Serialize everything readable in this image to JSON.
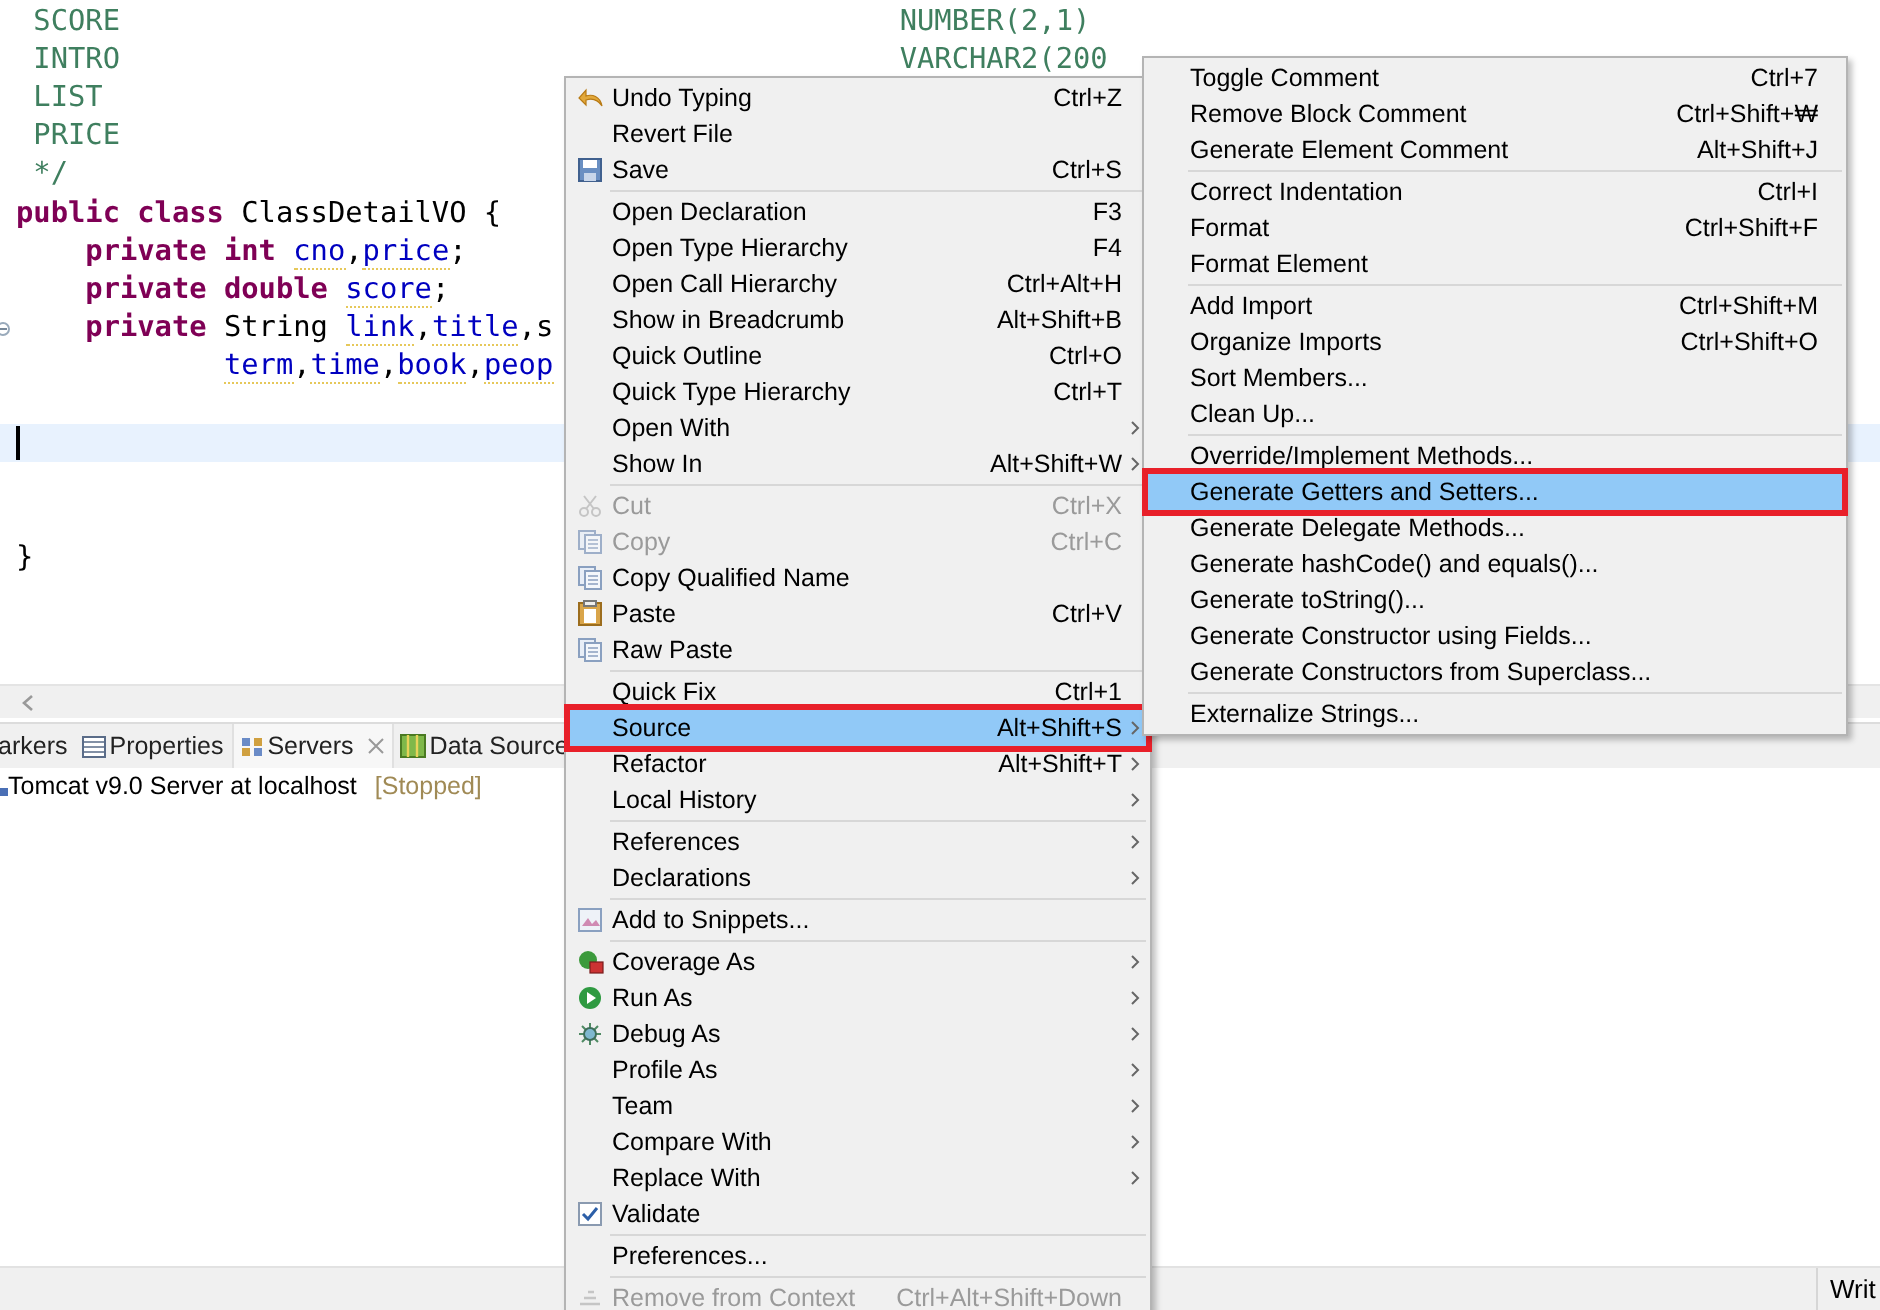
{
  "editor": {
    "lines": [
      {
        "kind": "comment",
        "current": false,
        "name": " SCORE",
        "type": "NUMBER(2,1)"
      },
      {
        "kind": "comment",
        "current": false,
        "name": " INTRO",
        "type": "VARCHAR2(200"
      },
      {
        "kind": "comment",
        "current": false,
        "name": " LIST"
      },
      {
        "kind": "comment",
        "current": false,
        "name": " PRICE"
      },
      {
        "kind": "comment",
        "current": false,
        "name": " */"
      },
      {
        "kind": "code",
        "current": false,
        "tokens": [
          {
            "kind": "keyword",
            "text": "public class"
          },
          {
            "kind": "plain",
            "text": " ClassDetailVO {"
          }
        ]
      },
      {
        "kind": "code",
        "current": false,
        "tokens": [
          {
            "kind": "keyword",
            "text": "    private int "
          },
          {
            "kind": "field",
            "text": "cno"
          },
          {
            "kind": "plain",
            "text": ","
          },
          {
            "kind": "field",
            "text": "price"
          },
          {
            "kind": "plain",
            "text": ";"
          }
        ]
      },
      {
        "kind": "code",
        "current": false,
        "tokens": [
          {
            "kind": "keyword",
            "text": "    private double "
          },
          {
            "kind": "field",
            "text": "score"
          },
          {
            "kind": "plain",
            "text": ";"
          }
        ]
      },
      {
        "kind": "code",
        "current": false,
        "folded": false,
        "tokens": [
          {
            "kind": "keyword",
            "text": "    private"
          },
          {
            "kind": "plain",
            "text": " String "
          },
          {
            "kind": "field",
            "text": "link"
          },
          {
            "kind": "plain",
            "text": ","
          },
          {
            "kind": "field",
            "text": "title"
          },
          {
            "kind": "plain",
            "text": ",s"
          }
        ]
      },
      {
        "kind": "code",
        "current": false,
        "tokens": [
          {
            "kind": "field",
            "text": "            term"
          },
          {
            "kind": "plain",
            "text": ","
          },
          {
            "kind": "field",
            "text": "time"
          },
          {
            "kind": "plain",
            "text": ","
          },
          {
            "kind": "field",
            "text": "book"
          },
          {
            "kind": "plain",
            "text": ","
          },
          {
            "kind": "field",
            "text": "peop"
          }
        ]
      },
      {
        "kind": "blank",
        "current": false
      },
      {
        "kind": "blank",
        "current": true
      },
      {
        "kind": "blank",
        "current": false
      },
      {
        "kind": "blank",
        "current": false
      },
      {
        "kind": "code",
        "current": false,
        "tokens": [
          {
            "kind": "plain",
            "text": "}"
          }
        ]
      }
    ]
  },
  "panel": {
    "tabs": [
      {
        "label": "arkers",
        "kind": "plain",
        "selected": false,
        "closable": false
      },
      {
        "label": "Properties",
        "kind": "table",
        "selected": false,
        "closable": false
      },
      {
        "label": "Servers",
        "kind": "servers",
        "selected": true,
        "closable": true
      },
      {
        "label": "Data Source",
        "kind": "map",
        "selected": false,
        "closable": false
      }
    ],
    "rows": [
      {
        "name": "Tomcat v9.0 Server at localhost",
        "status": "[Stopped]"
      }
    ]
  },
  "status_bar": {
    "mode": "Writ"
  },
  "context_menu": {
    "groups": [
      [
        {
          "label": "Undo Typing",
          "shortcut": "Ctrl+Z",
          "kind": "undo",
          "submenu": false,
          "disabled": false,
          "selected": false
        },
        {
          "label": "Revert File",
          "kind": "plain",
          "submenu": false,
          "disabled": false,
          "selected": false
        },
        {
          "label": "Save",
          "shortcut": "Ctrl+S",
          "kind": "save",
          "submenu": false,
          "disabled": false,
          "selected": false
        }
      ],
      [
        {
          "label": "Open Declaration",
          "shortcut": "F3",
          "kind": "plain",
          "submenu": false,
          "disabled": false,
          "selected": false
        },
        {
          "label": "Open Type Hierarchy",
          "shortcut": "F4",
          "kind": "plain",
          "submenu": false,
          "disabled": false,
          "selected": false
        },
        {
          "label": "Open Call Hierarchy",
          "shortcut": "Ctrl+Alt+H",
          "kind": "plain",
          "submenu": false,
          "disabled": false,
          "selected": false
        },
        {
          "label": "Show in Breadcrumb",
          "shortcut": "Alt+Shift+B",
          "kind": "plain",
          "submenu": false,
          "disabled": false,
          "selected": false
        },
        {
          "label": "Quick Outline",
          "shortcut": "Ctrl+O",
          "kind": "plain",
          "submenu": false,
          "disabled": false,
          "selected": false
        },
        {
          "label": "Quick Type Hierarchy",
          "shortcut": "Ctrl+T",
          "kind": "plain",
          "submenu": false,
          "disabled": false,
          "selected": false
        },
        {
          "label": "Open With",
          "kind": "plain",
          "submenu": true,
          "disabled": false,
          "selected": false
        },
        {
          "label": "Show In",
          "shortcut": "Alt+Shift+W",
          "kind": "plain",
          "submenu": true,
          "disabled": false,
          "selected": false
        }
      ],
      [
        {
          "label": "Cut",
          "shortcut": "Ctrl+X",
          "kind": "cut",
          "submenu": false,
          "disabled": true,
          "selected": false
        },
        {
          "label": "Copy",
          "shortcut": "Ctrl+C",
          "kind": "copy",
          "submenu": false,
          "disabled": true,
          "selected": false
        },
        {
          "label": "Copy Qualified Name",
          "kind": "copy",
          "submenu": false,
          "disabled": false,
          "selected": false
        },
        {
          "label": "Paste",
          "shortcut": "Ctrl+V",
          "kind": "paste",
          "submenu": false,
          "disabled": false,
          "selected": false
        },
        {
          "label": "Raw Paste",
          "kind": "copy",
          "submenu": false,
          "disabled": false,
          "selected": false
        }
      ],
      [
        {
          "label": "Quick Fix",
          "shortcut": "Ctrl+1",
          "kind": "plain",
          "submenu": false,
          "disabled": false,
          "selected": false
        },
        {
          "label": "Source",
          "shortcut": "Alt+Shift+S",
          "kind": "plain",
          "submenu": true,
          "disabled": false,
          "selected": true
        },
        {
          "label": "Refactor",
          "shortcut": "Alt+Shift+T",
          "kind": "plain",
          "submenu": true,
          "disabled": false,
          "selected": false
        },
        {
          "label": "Local History",
          "kind": "plain",
          "submenu": true,
          "disabled": false,
          "selected": false
        }
      ],
      [
        {
          "label": "References",
          "kind": "plain",
          "submenu": true,
          "disabled": false,
          "selected": false
        },
        {
          "label": "Declarations",
          "kind": "plain",
          "submenu": true,
          "disabled": false,
          "selected": false
        }
      ],
      [
        {
          "label": "Add to Snippets...",
          "kind": "snippet",
          "submenu": false,
          "disabled": false,
          "selected": false
        }
      ],
      [
        {
          "label": "Coverage As",
          "kind": "coverage",
          "submenu": true,
          "disabled": false,
          "selected": false
        },
        {
          "label": "Run As",
          "kind": "run",
          "submenu": true,
          "disabled": false,
          "selected": false
        },
        {
          "label": "Debug As",
          "kind": "debug",
          "submenu": true,
          "disabled": false,
          "selected": false
        },
        {
          "label": "Profile As",
          "kind": "plain",
          "submenu": true,
          "disabled": false,
          "selected": false
        },
        {
          "label": "Team",
          "kind": "plain",
          "submenu": true,
          "disabled": false,
          "selected": false
        },
        {
          "label": "Compare With",
          "kind": "plain",
          "submenu": true,
          "disabled": false,
          "selected": false
        },
        {
          "label": "Replace With",
          "kind": "plain",
          "submenu": true,
          "disabled": false,
          "selected": false
        },
        {
          "label": "Validate",
          "kind": "checkbox",
          "checked": true,
          "submenu": false,
          "disabled": false,
          "selected": false
        }
      ],
      [
        {
          "label": "Preferences...",
          "kind": "plain",
          "submenu": false,
          "disabled": false,
          "selected": false
        }
      ],
      [
        {
          "label": "Remove from Context",
          "shortcut": "Ctrl+Alt+Shift+Down",
          "kind": "context",
          "submenu": false,
          "disabled": true,
          "selected": false
        }
      ]
    ]
  },
  "source_submenu": {
    "groups": [
      [
        {
          "label": "Toggle Comment",
          "shortcut": "Ctrl+7",
          "submenu": false,
          "disabled": false,
          "selected": false
        },
        {
          "label": "Remove Block Comment",
          "shortcut": "Ctrl+Shift+₩",
          "submenu": false,
          "disabled": false,
          "selected": false
        },
        {
          "label": "Generate Element Comment",
          "shortcut": "Alt+Shift+J",
          "submenu": false,
          "disabled": false,
          "selected": false
        }
      ],
      [
        {
          "label": "Correct Indentation",
          "shortcut": "Ctrl+I",
          "submenu": false,
          "disabled": false,
          "selected": false
        },
        {
          "label": "Format",
          "shortcut": "Ctrl+Shift+F",
          "submenu": false,
          "disabled": false,
          "selected": false
        },
        {
          "label": "Format Element",
          "submenu": false,
          "disabled": false,
          "selected": false
        }
      ],
      [
        {
          "label": "Add Import",
          "shortcut": "Ctrl+Shift+M",
          "submenu": false,
          "disabled": false,
          "selected": false
        },
        {
          "label": "Organize Imports",
          "shortcut": "Ctrl+Shift+O",
          "submenu": false,
          "disabled": false,
          "selected": false
        },
        {
          "label": "Sort Members...",
          "submenu": false,
          "disabled": false,
          "selected": false
        },
        {
          "label": "Clean Up...",
          "submenu": false,
          "disabled": false,
          "selected": false
        }
      ],
      [
        {
          "label": "Override/Implement Methods...",
          "submenu": false,
          "disabled": false,
          "selected": false
        },
        {
          "label": "Generate Getters and Setters...",
          "submenu": false,
          "disabled": false,
          "selected": true
        },
        {
          "label": "Generate Delegate Methods...",
          "submenu": false,
          "disabled": false,
          "selected": false
        },
        {
          "label": "Generate hashCode() and equals()...",
          "submenu": false,
          "disabled": false,
          "selected": false
        },
        {
          "label": "Generate toString()...",
          "submenu": false,
          "disabled": false,
          "selected": false
        },
        {
          "label": "Generate Constructor using Fields...",
          "submenu": false,
          "disabled": false,
          "selected": false
        },
        {
          "label": "Generate Constructors from Superclass...",
          "submenu": false,
          "disabled": false,
          "selected": false
        }
      ],
      [
        {
          "label": "Externalize Strings...",
          "submenu": false,
          "disabled": false,
          "selected": false
        }
      ]
    ]
  }
}
